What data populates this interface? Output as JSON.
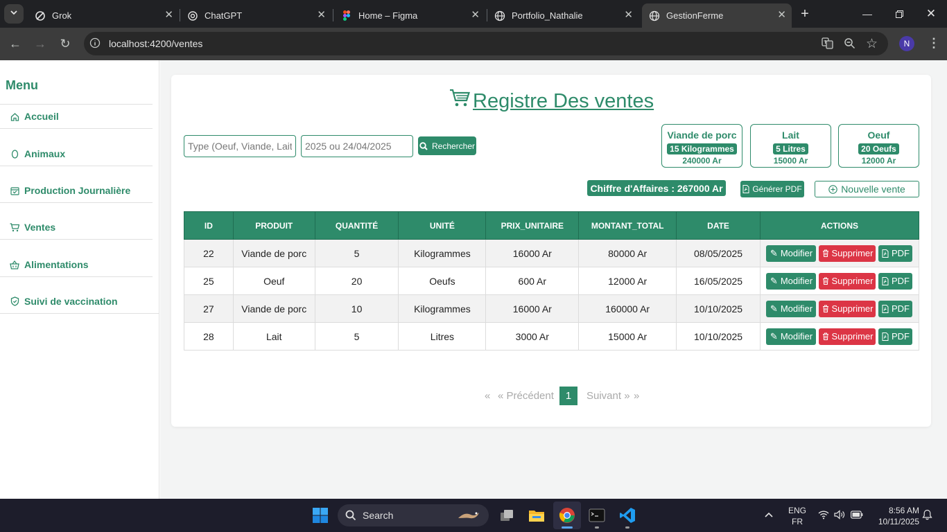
{
  "browser": {
    "tabs": [
      {
        "label": "Grok"
      },
      {
        "label": "ChatGPT"
      },
      {
        "label": "Home – Figma"
      },
      {
        "label": "Portfolio_Nathalie"
      },
      {
        "label": "GestionFerme"
      }
    ],
    "url": "localhost:4200/ventes",
    "profile_initial": "N"
  },
  "sidebar": {
    "title": "Menu",
    "items": [
      {
        "label": "Accueil",
        "icon": "home-icon"
      },
      {
        "label": "Animaux",
        "icon": "egg-icon"
      },
      {
        "label": "Production Journalière",
        "icon": "calendar-check-icon"
      },
      {
        "label": "Ventes",
        "icon": "cart-icon"
      },
      {
        "label": "Alimentations",
        "icon": "basket-icon"
      },
      {
        "label": "Suivi de vaccination",
        "icon": "shield-icon"
      }
    ]
  },
  "page": {
    "title": "Registre Des ventes",
    "filter": {
      "type_placeholder": "Type (Oeuf, Viande, Lait)",
      "date_placeholder": "2025 ou 24/04/2025",
      "search_label": "Rechercher"
    },
    "stocks": [
      {
        "name": "Viande de porc",
        "quantity": "15 Kilogrammes",
        "amount": "240000 Ar"
      },
      {
        "name": "Lait",
        "quantity": "5 Litres",
        "amount": "15000 Ar"
      },
      {
        "name": "Oeuf",
        "quantity": "20 Oeufs",
        "amount": "12000 Ar"
      }
    ],
    "chiffre_affaires": "Chiffre d'Affaires : 267000 Ar",
    "generate_pdf_label": "Générer PDF",
    "new_sale_label": "Nouvelle vente",
    "table": {
      "headers": [
        "ID",
        "PRODUIT",
        "QUANTITÉ",
        "UNITÉ",
        "PRIX_UNITAIRE",
        "MONTANT_TOTAL",
        "DATE",
        "ACTIONS"
      ],
      "rows": [
        [
          "22",
          "Viande de porc",
          "5",
          "Kilogrammes",
          "16000 Ar",
          "80000 Ar",
          "08/05/2025"
        ],
        [
          "25",
          "Oeuf",
          "20",
          "Oeufs",
          "600 Ar",
          "12000 Ar",
          "16/05/2025"
        ],
        [
          "27",
          "Viande de porc",
          "10",
          "Kilogrammes",
          "16000 Ar",
          "160000 Ar",
          "10/10/2025"
        ],
        [
          "28",
          "Lait",
          "5",
          "Litres",
          "3000 Ar",
          "15000 Ar",
          "10/10/2025"
        ]
      ],
      "action_labels": {
        "edit": "Modifier",
        "delete": "Supprimer",
        "pdf": "PDF"
      }
    },
    "pagination": {
      "first": "«",
      "prev": "« Précédent",
      "current": "1",
      "next": "Suivant »",
      "last": "»"
    }
  },
  "taskbar": {
    "search_label": "Search",
    "lang1": "ENG",
    "lang2": "FR",
    "time": "8:56 AM",
    "date": "10/11/2025"
  },
  "colors": {
    "accent": "#2e8b6a",
    "danger": "#dc3545"
  }
}
